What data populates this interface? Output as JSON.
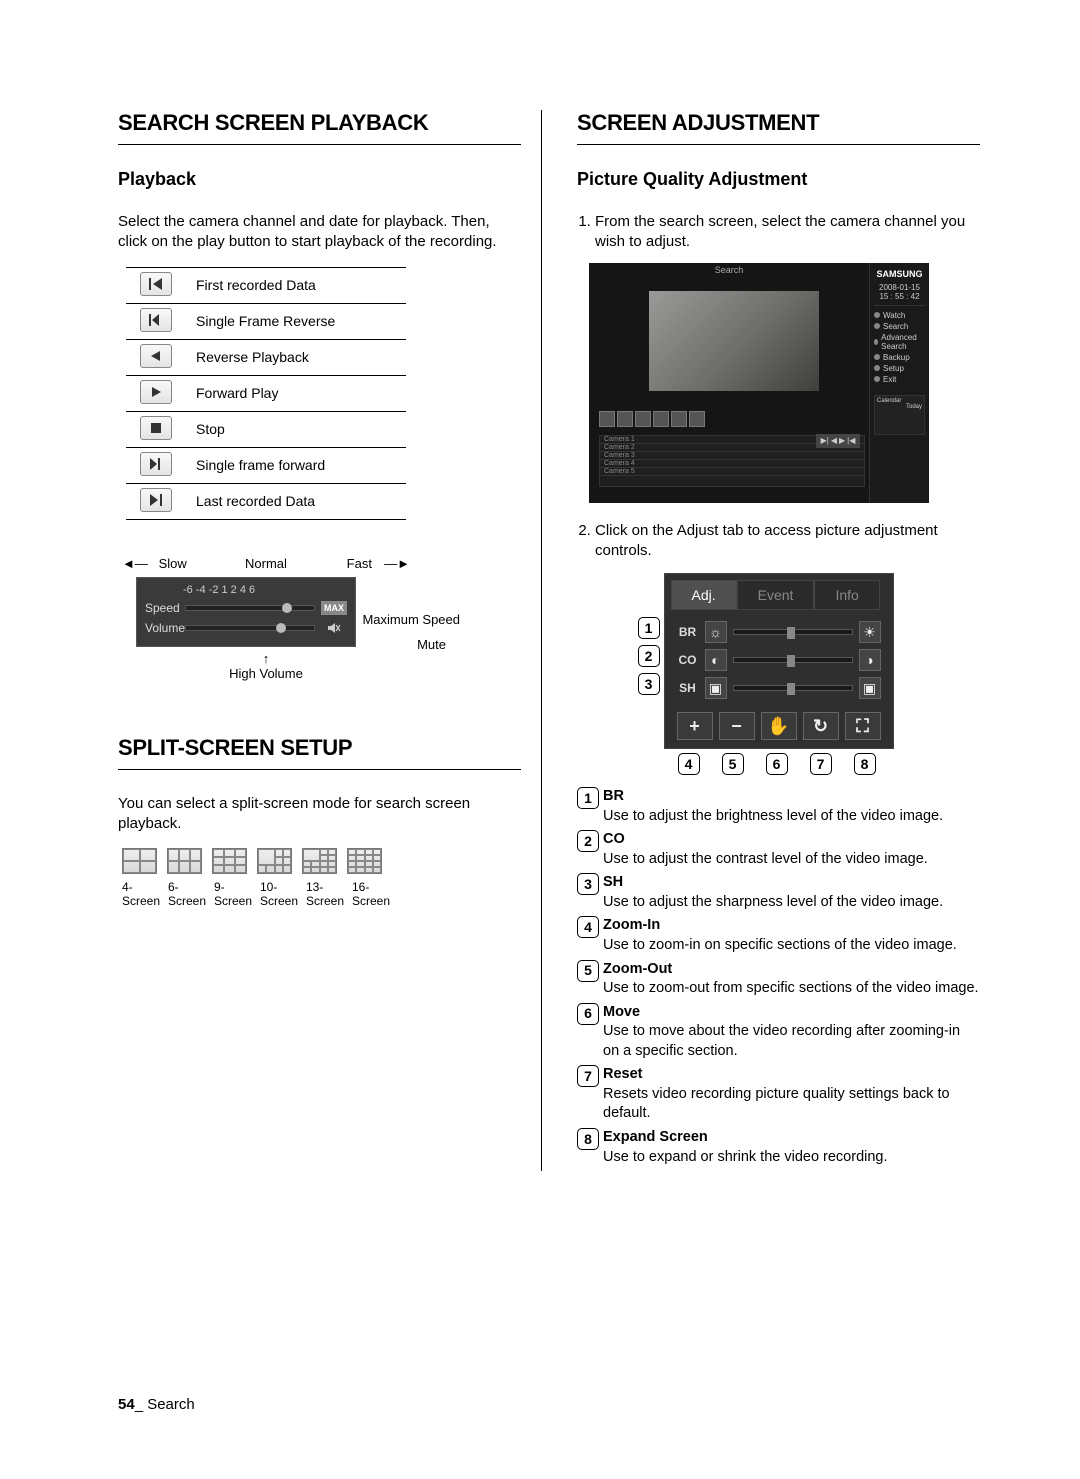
{
  "left": {
    "h1a": "SEARCH SCREEN PLAYBACK",
    "h2a": "Playback",
    "intro": "Select the camera channel and date for playback. Then, click on the play button to start playback of the recording.",
    "table": {
      "r1": "First recorded Data",
      "r2": "Single Frame Reverse",
      "r3": "Reverse Playback",
      "r4": "Forward Play",
      "r5": "Stop",
      "r6": "Single frame forward",
      "r7": "Last recorded Data"
    },
    "speed": {
      "slow": "Slow",
      "normal": "Normal",
      "fast": "Fast",
      "ticks": "-6  -4  -2   1   2   4   6",
      "speed_lbl": "Speed",
      "volume_lbl": "Volume",
      "max": "MAX",
      "max_side": "Maximum Speed",
      "mute_side": "Mute",
      "highvol": "High Volume"
    },
    "h1b": "SPLIT-SCREEN SETUP",
    "split_intro": "You can select a split-screen mode for search screen playback.",
    "split": {
      "s4": "4-Screen",
      "s6": "6-Screen",
      "s9": "9-Screen",
      "s10": "10-Screen",
      "s13": "13-Screen",
      "s16": "16-Screen"
    }
  },
  "right": {
    "h1": "SCREEN ADJUSTMENT",
    "h2": "Picture Quality Adjustment",
    "step1": "From the search screen, select the camera channel you wish to adjust.",
    "step2": "Click on the Adjust tab to access picture adjustment controls.",
    "ss": {
      "title": "Search",
      "logo": "SAMSUNG",
      "date": "2008-01-15",
      "time": "15 : 55 : 42",
      "m_watch": "Watch",
      "m_search": "Search",
      "m_adv": "Advanced Search",
      "m_backup": "Backup",
      "m_setup": "Setup",
      "m_exit": "Exit",
      "cal": "Calendar",
      "today": "Today",
      "cam1": "Camera 1",
      "cam2": "Camera 2",
      "cam3": "Camera 3",
      "cam4": "Camera 4",
      "cam5": "Camera 5"
    },
    "adj": {
      "tab_adj": "Adj.",
      "tab_event": "Event",
      "tab_info": "Info",
      "br": "BR",
      "co": "CO",
      "sh": "SH"
    },
    "legend": {
      "l1_lbl": "BR",
      "l1_txt": "Use to adjust the brightness level of the video image.",
      "l2_lbl": "CO",
      "l2_txt": "Use to adjust the contrast level of the video image.",
      "l3_lbl": "SH",
      "l3_txt": "Use to adjust the sharpness level of the video image.",
      "l4_lbl": "Zoom-In",
      "l4_txt": "Use to zoom-in on specific sections of the video image.",
      "l5_lbl": "Zoom-Out",
      "l5_txt": "Use to zoom-out from specific sections of the video image.",
      "l6_lbl": "Move",
      "l6_txt": "Use to move about the video recording after zooming-in on a specific section.",
      "l7_lbl": "Reset",
      "l7_txt": "Resets video recording picture quality settings back to default.",
      "l8_lbl": "Expand Screen",
      "l8_txt": "Use to expand or shrink the video recording."
    }
  },
  "footer": {
    "page": "54",
    "section": "Search"
  }
}
